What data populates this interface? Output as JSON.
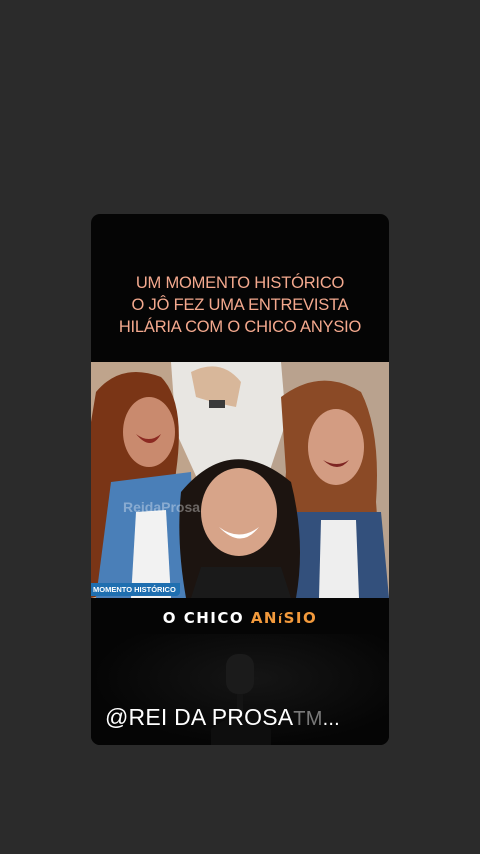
{
  "caption": {
    "lines": [
      "UM MOMENTO HISTÓRICO",
      "O JÔ FEZ UMA ENTREVISTA",
      "HILÁRIA COM O CHICO ANYSIO"
    ]
  },
  "video": {
    "watermark": "ReidaProsa",
    "segment_tag": "MOMENTO HISTÓRICO"
  },
  "subtitle": {
    "part1": "O CHICO ",
    "part2": "AN",
    "part3": "í",
    "part4": "SIO"
  },
  "handle": {
    "text": "@REI DA PROSA",
    "faded": "TM",
    "ellipsis": "..."
  },
  "colors": {
    "background": "#2b2b2b",
    "card": "#050505",
    "caption": "#f4a98e",
    "highlight": "#f39a3c",
    "tag": "#1f6fb0"
  }
}
